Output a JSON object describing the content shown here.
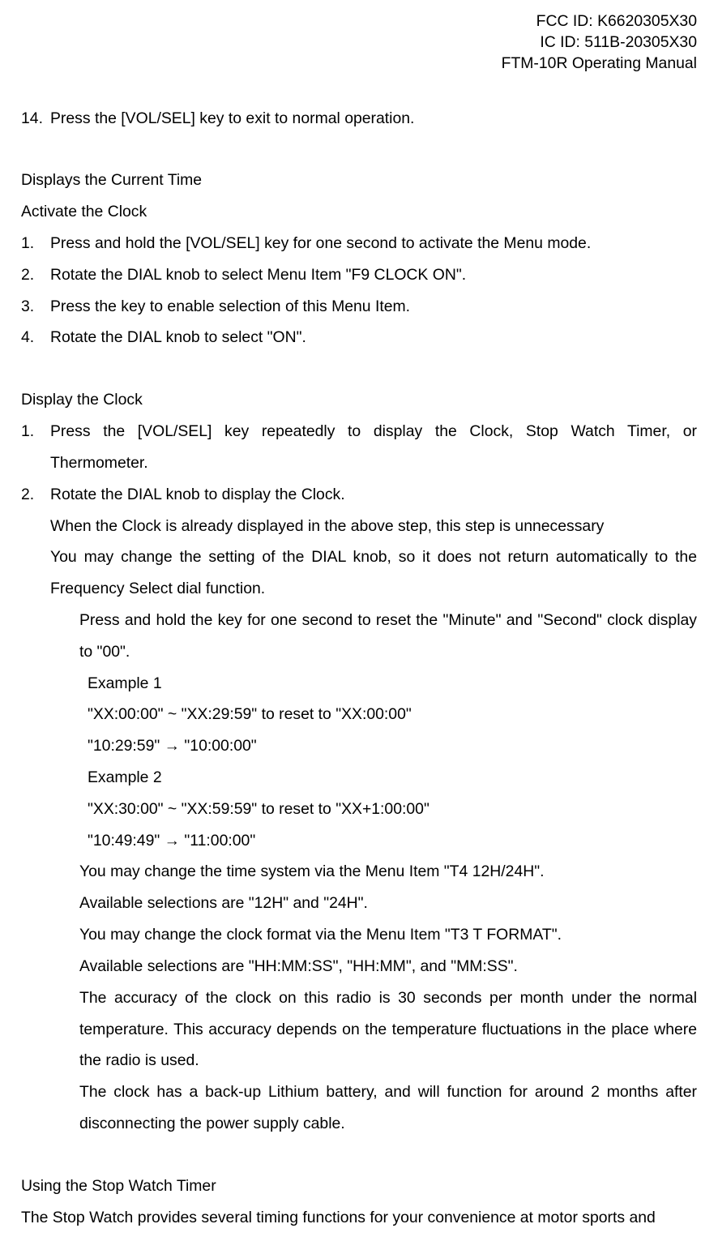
{
  "header": {
    "fcc_id": "FCC ID: K6620305X30",
    "ic_id": "IC ID: 511B-20305X30",
    "manual_name": "FTM-10R Operating Manual"
  },
  "step14": {
    "num": "14.",
    "text": "Press the [VOL/SEL] key to exit to normal operation."
  },
  "section1_heading": "Displays the Current Time",
  "section1_sub": "Activate the Clock",
  "activate": {
    "s1_num": "1.",
    "s1_text": "Press and hold the [VOL/SEL] key for one second to activate the Menu mode.",
    "s2_num": "2.",
    "s2_text": "Rotate the DIAL knob to select Menu Item \"F9 CLOCK ON\".",
    "s3_num": "3.",
    "s3_text": "Press the   key to enable selection of this Menu Item.",
    "s4_num": "4.",
    "s4_text": "Rotate the DIAL knob to select \"ON\"."
  },
  "section2_sub": "Display the Clock",
  "display": {
    "s1_num": "1.",
    "s1_text": "Press the [VOL/SEL] key repeatedly to display the Clock, Stop Watch Timer, or Thermometer.",
    "s2_num": "2.",
    "s2_text": "Rotate the DIAL knob to display the Clock.",
    "s2_note1": "When the Clock is already displayed in the above step, this step is unnecessary",
    "s2_note2": "You may change the setting of the DIAL knob, so it does not return automatically to the Frequency Select dial function.",
    "reset_note": "Press and hold the   key for one second to reset the \"Minute\" and \"Second\" clock display to \"00\".",
    "ex1_label": "Example 1",
    "ex1_line1": "\"XX:00:00\" ~ \"XX:29:59\" to reset to \"XX:00:00\"",
    "ex1_line2": "\"10:29:59\" → \"10:00:00\"",
    "ex2_label": "Example 2",
    "ex2_line1": "\"XX:30:00\" ~ \"XX:59:59\" to reset to \"XX+1:00:00\"",
    "ex2_line2": "\"10:49:49\" → \"11:00:00\"",
    "time_system": "You may change the time system via the Menu Item \"T4 12H/24H\".",
    "time_system_opts": "Available selections are \"12H\" and \"24H\".",
    "clock_format": "You may change the clock format via the Menu Item \"T3 T FORMAT\".",
    "clock_format_opts": "Available selections are \"HH:MM:SS\", \"HH:MM\", and \"MM:SS\".",
    "accuracy": "The accuracy of the clock on this radio is 30 seconds per month under the normal temperature. This accuracy depends on the temperature fluctuations in the place where the radio is used.",
    "battery": "The clock has a back-up Lithium battery, and will function for around 2 months after disconnecting the power supply cable."
  },
  "section3_heading": "Using the Stop Watch Timer",
  "section3_intro": "The Stop Watch provides several timing functions for your convenience at motor sports and"
}
